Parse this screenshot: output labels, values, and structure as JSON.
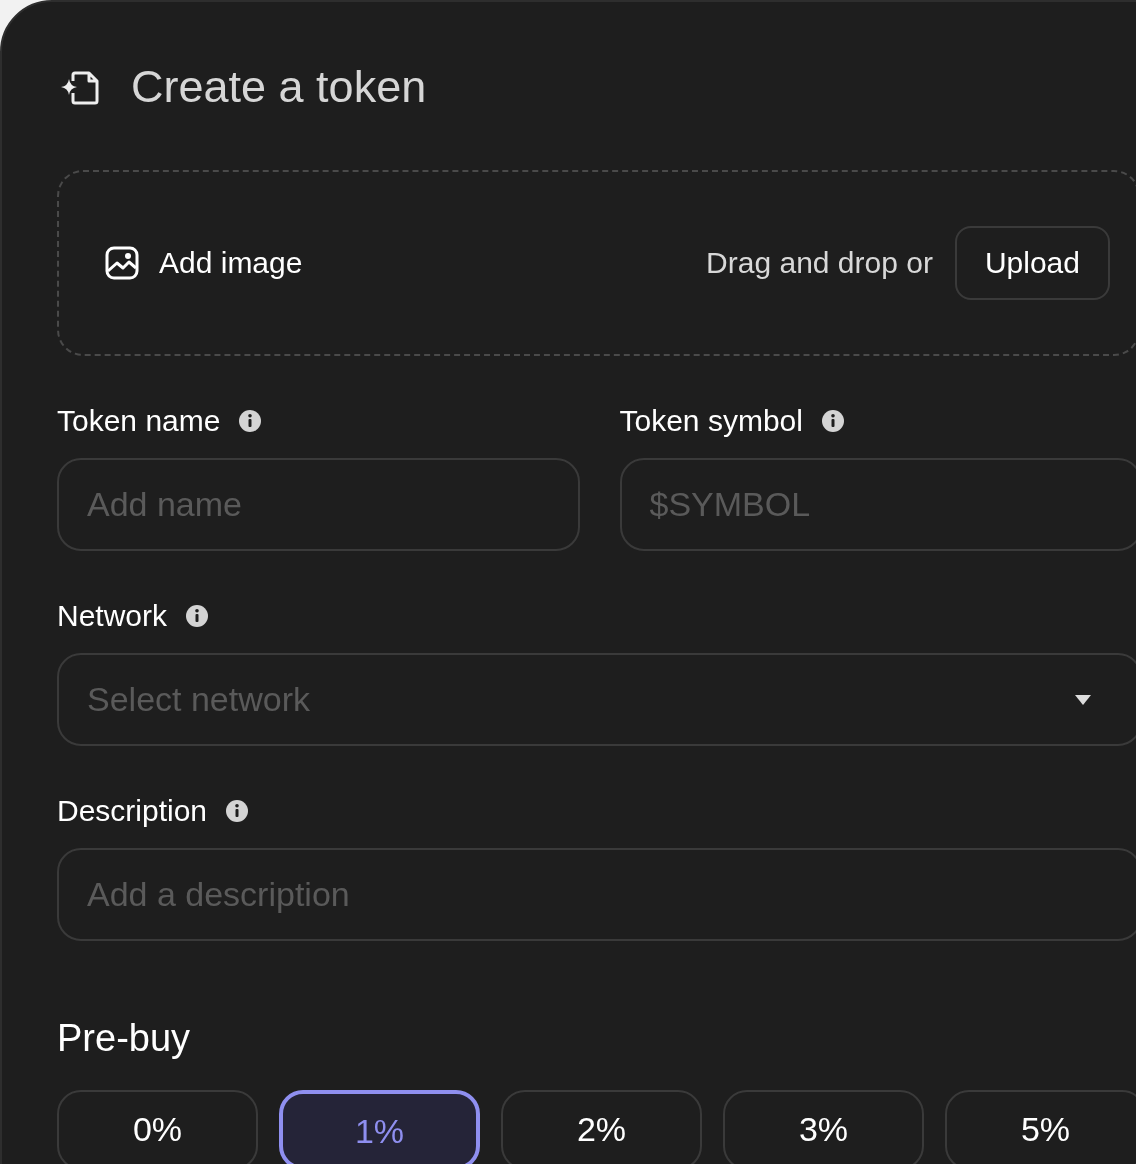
{
  "title": "Create a token",
  "image_drop": {
    "label": "Add image",
    "hint": "Drag and drop or",
    "button": "Upload"
  },
  "field_rows": [
    [
      {
        "label": "Token name",
        "placeholder": "Add name",
        "kind": "text"
      },
      {
        "label": "Token symbol",
        "placeholder": "$SYMBOL",
        "kind": "text"
      }
    ],
    [
      {
        "label": "Network",
        "placeholder": "Select network",
        "kind": "select"
      }
    ],
    [
      {
        "label": "Description",
        "placeholder": "Add a description",
        "kind": "text"
      }
    ]
  ],
  "prebuy": {
    "title": "Pre-buy",
    "options": [
      {
        "label": "0%",
        "selected": false
      },
      {
        "label": "1%",
        "selected": true
      },
      {
        "label": "2%",
        "selected": false
      },
      {
        "label": "3%",
        "selected": false
      },
      {
        "label": "5%",
        "selected": false
      }
    ]
  }
}
